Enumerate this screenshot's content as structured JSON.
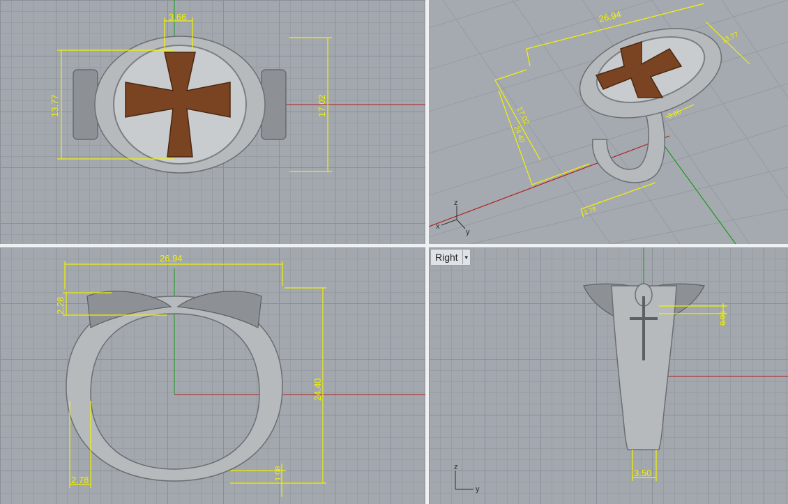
{
  "viewports": {
    "top": {
      "dims": {
        "a": "3.66",
        "b": "13.77",
        "c": "17.02"
      }
    },
    "perspective": {
      "dims": {
        "a": "26.94",
        "b": "13.77",
        "c": "17.02",
        "d": "24.40",
        "e": "3.66",
        "f": "2.78"
      },
      "axes": {
        "z": "z",
        "x": "x",
        "y": "y"
      }
    },
    "front": {
      "dims": {
        "width": "26.94",
        "top": "2.28",
        "height": "24.40",
        "bottom_left": "2.78",
        "bottom_right": "1.08"
      }
    },
    "right": {
      "label": "Right",
      "dims": {
        "top": "0.95",
        "bottom": "3.50"
      },
      "axes": {
        "z": "z",
        "y": "y"
      }
    }
  },
  "colors": {
    "grid": "#a2a8ae",
    "dimension": "#f2f200",
    "x_axis": "#b01e1e",
    "y_axis": "#1a9a1a",
    "cross": "#7a4322"
  }
}
